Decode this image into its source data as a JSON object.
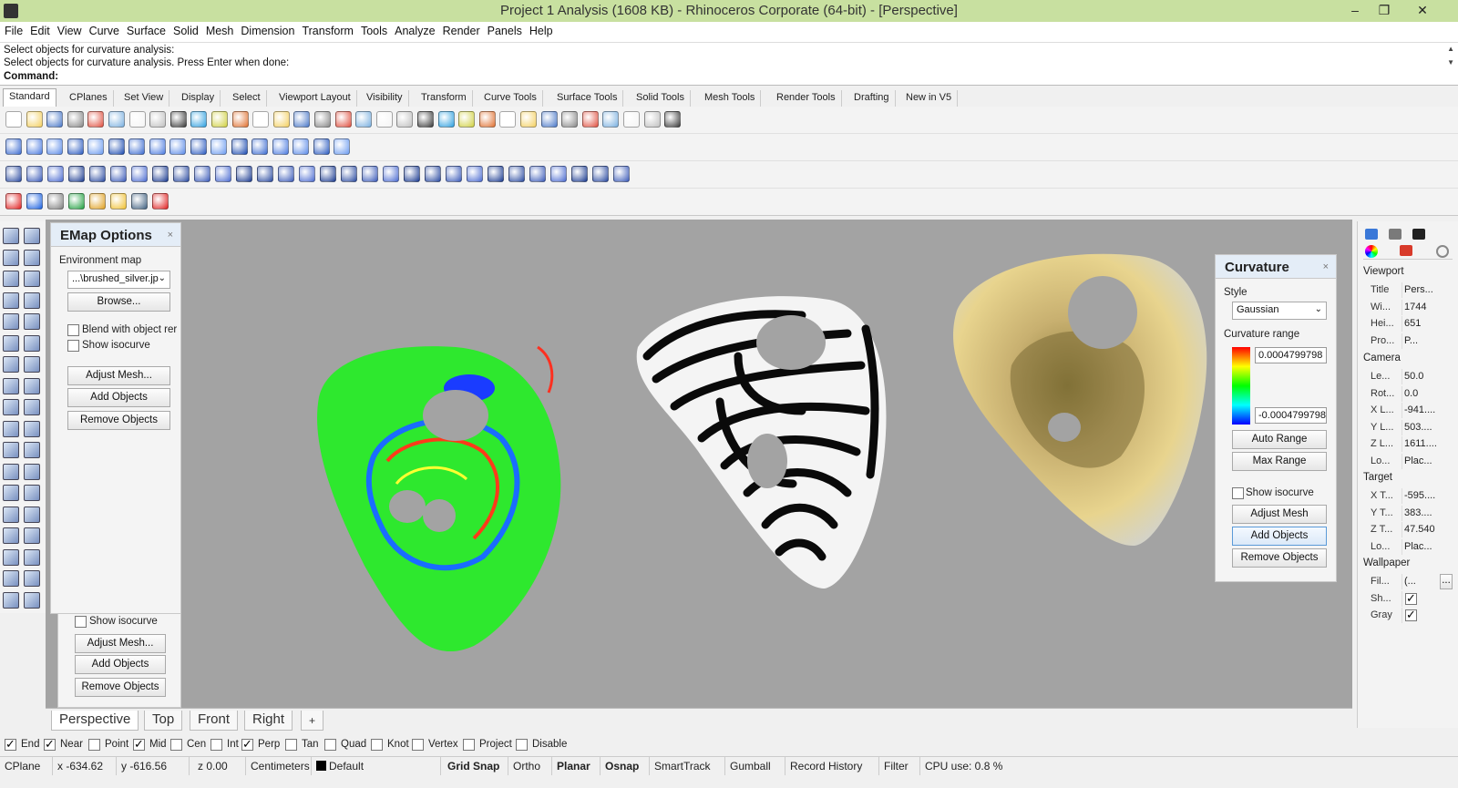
{
  "window": {
    "title": "Project 1 Analysis (1608 KB) - Rhinoceros Corporate (64-bit) - [Perspective]",
    "min": "–",
    "max": "❐",
    "close": "✕"
  },
  "menu": [
    "File",
    "Edit",
    "View",
    "Curve",
    "Surface",
    "Solid",
    "Mesh",
    "Dimension",
    "Transform",
    "Tools",
    "Analyze",
    "Render",
    "Panels",
    "Help"
  ],
  "command": {
    "history1": "Select objects for curvature analysis:",
    "history2": "Select objects for curvature analysis. Press Enter when done:",
    "label": "Command:",
    "value": ""
  },
  "toolbar_tabs": [
    "Standard",
    "CPlanes",
    "Set View",
    "Display",
    "Select",
    "Viewport Layout",
    "Visibility",
    "Transform",
    "Curve Tools",
    "Surface Tools",
    "Solid Tools",
    "Mesh Tools",
    "Render Tools",
    "Drafting",
    "New in V5"
  ],
  "emap": {
    "title": "EMap Options",
    "close": "×",
    "env_label": "Environment map",
    "env_value": "...\\brushed_silver.jp",
    "browse": "Browse...",
    "blend": "Blend with object rer",
    "isocurve": "Show isocurve",
    "adjust": "Adjust Mesh...",
    "add": "Add Objects",
    "remove": "Remove Objects"
  },
  "zebra_panel": {
    "isocurve": "Show isocurve",
    "adjust": "Adjust Mesh...",
    "add": "Add Objects",
    "remove": "Remove Objects"
  },
  "curvature": {
    "title": "Curvature",
    "close": "×",
    "style_label": "Style",
    "style_value": "Gaussian",
    "range_label": "Curvature range",
    "max": "0.0004799798",
    "min": "-0.0004799798",
    "auto": "Auto Range",
    "maxrange": "Max Range",
    "isocurve": "Show isocurve",
    "adjust": "Adjust Mesh",
    "add": "Add Objects",
    "remove": "Remove Objects"
  },
  "properties": {
    "viewport": "Viewport",
    "rows1": [
      {
        "k": "Title",
        "v": "Pers..."
      },
      {
        "k": "Wi...",
        "v": "1744"
      },
      {
        "k": "Hei...",
        "v": "651"
      },
      {
        "k": "Pro...",
        "v": "P..."
      }
    ],
    "camera": "Camera",
    "rows2": [
      {
        "k": "Le...",
        "v": "50.0"
      },
      {
        "k": "Rot...",
        "v": "0.0"
      },
      {
        "k": "X L...",
        "v": "-941...."
      },
      {
        "k": "Y L...",
        "v": "503...."
      },
      {
        "k": "Z L...",
        "v": "1611...."
      },
      {
        "k": "Lo...",
        "v": "Plac..."
      }
    ],
    "target": "Target",
    "rows3": [
      {
        "k": "X T...",
        "v": "-595...."
      },
      {
        "k": "Y T...",
        "v": "383...."
      },
      {
        "k": "Z T...",
        "v": "47.540"
      },
      {
        "k": "Lo...",
        "v": "Plac..."
      }
    ],
    "wallpaper": "Wallpaper",
    "rows4": [
      {
        "k": "Fil...",
        "v": "(..."
      },
      {
        "k": "Sh...",
        "v": ""
      },
      {
        "k": "Gray",
        "v": ""
      }
    ],
    "more": "..."
  },
  "viewport_tabs": [
    "Perspective",
    "Top",
    "Front",
    "Right",
    "+"
  ],
  "osnaps": [
    {
      "label": "End",
      "checked": true
    },
    {
      "label": "Near",
      "checked": true
    },
    {
      "label": "Point",
      "checked": false
    },
    {
      "label": "Mid",
      "checked": true
    },
    {
      "label": "Cen",
      "checked": false
    },
    {
      "label": "Int",
      "checked": false
    },
    {
      "label": "Perp",
      "checked": true
    },
    {
      "label": "Tan",
      "checked": false
    },
    {
      "label": "Quad",
      "checked": false
    },
    {
      "label": "Knot",
      "checked": false
    },
    {
      "label": "Vertex",
      "checked": false
    },
    {
      "label": "Project",
      "checked": false
    },
    {
      "label": "Disable",
      "checked": false
    }
  ],
  "status": {
    "cplane": "CPlane",
    "x": "x -634.62",
    "y": "y -616.56",
    "z": "z 0.00",
    "units": "Centimeters",
    "layer": "Default",
    "gridsnap": "Grid Snap",
    "ortho": "Ortho",
    "planar": "Planar",
    "osnap": "Osnap",
    "smarttrack": "SmartTrack",
    "gumball": "Gumball",
    "record": "Record History",
    "filter": "Filter",
    "cpu": "CPU use: 0.8 %"
  },
  "colors": {
    "titlebar": "#c8e0a0",
    "viewport_bg": "#a3a3a3",
    "panel_head": "#e4edf7"
  }
}
